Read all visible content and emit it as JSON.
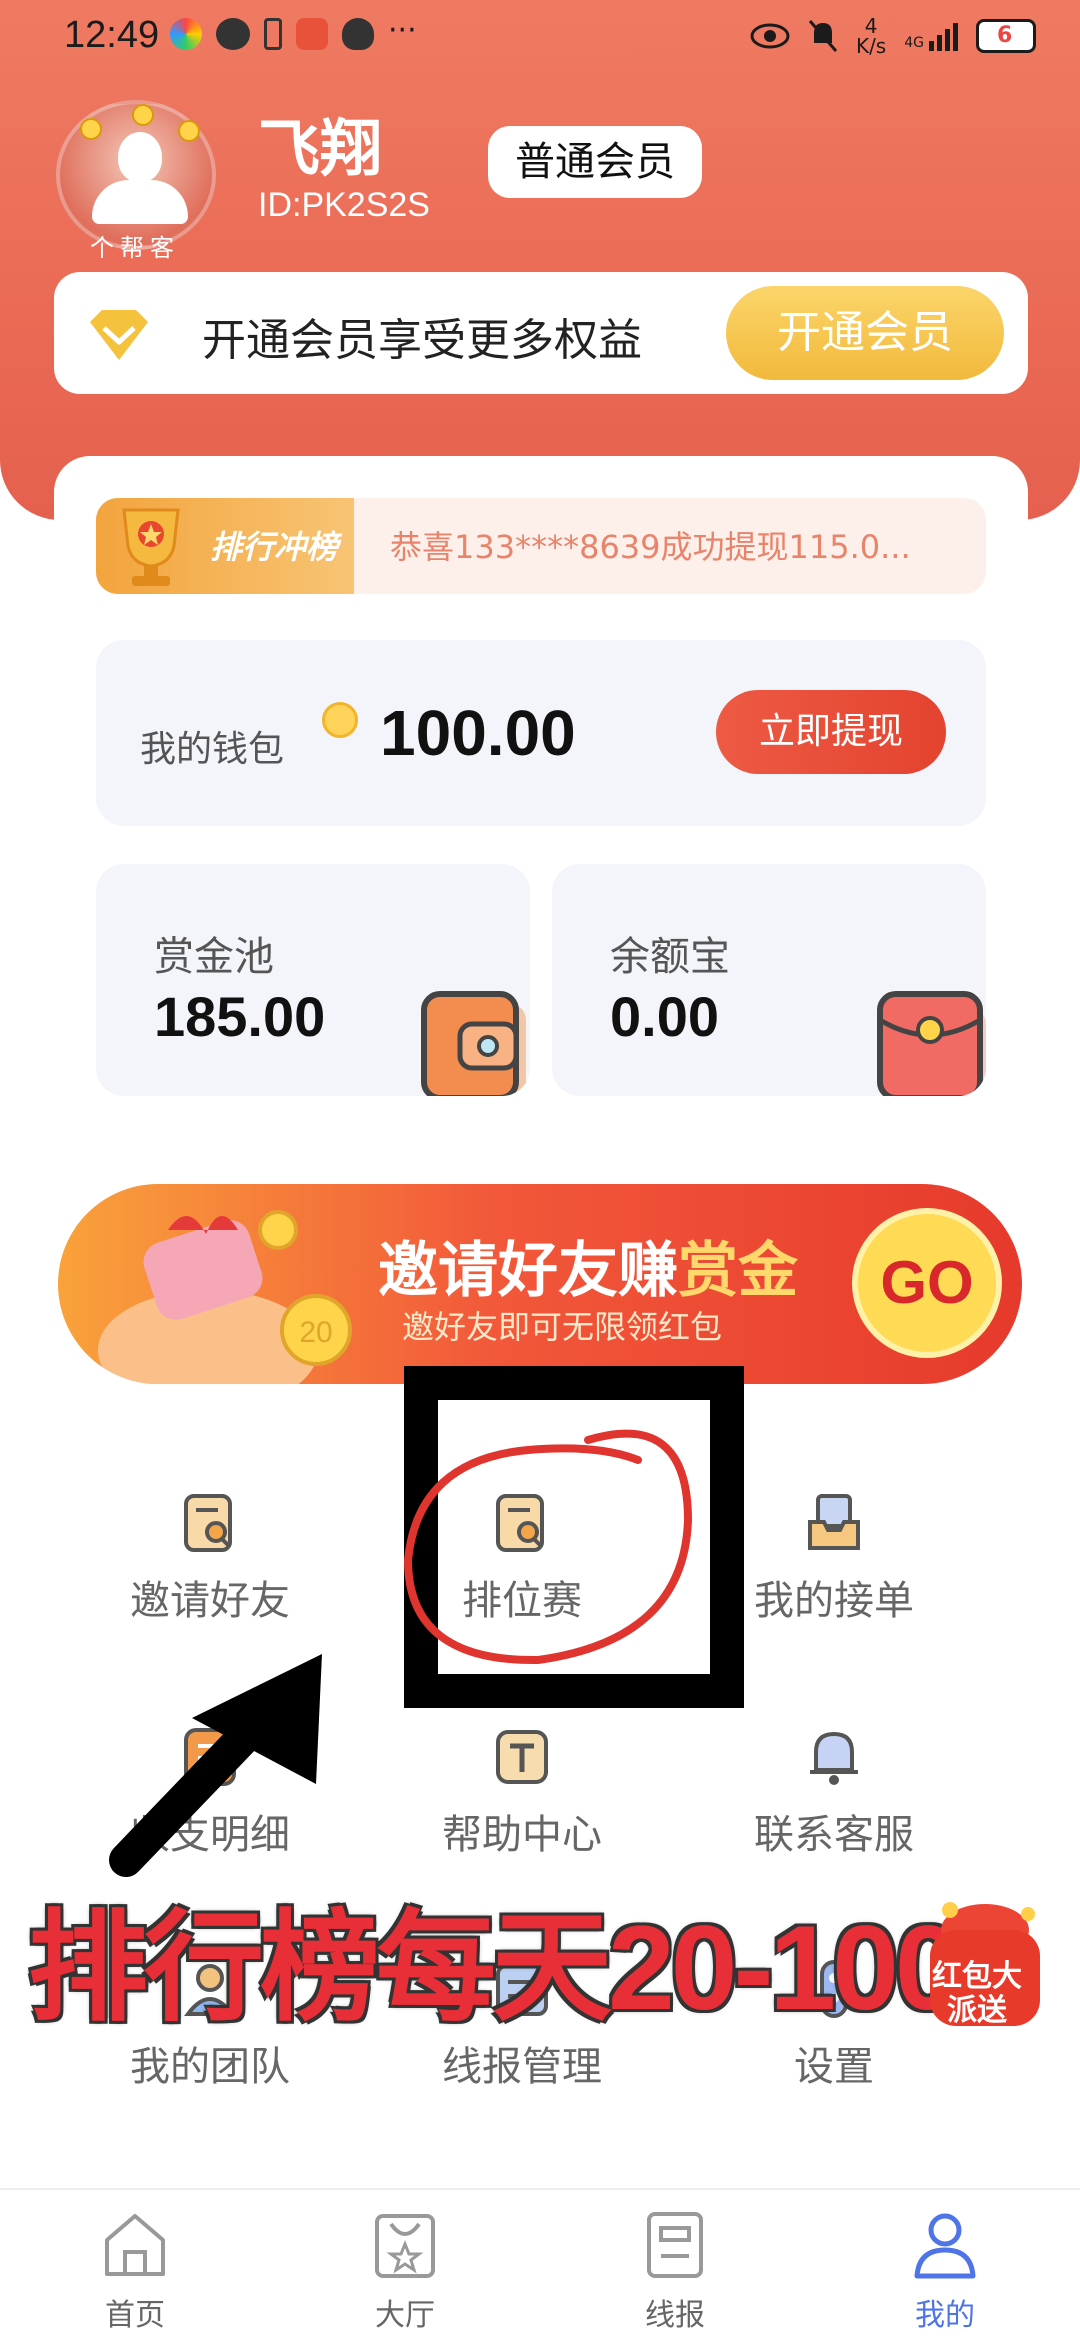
{
  "status_bar": {
    "time": "12:49",
    "net_speed_value": "4",
    "net_speed_unit": "K/s",
    "network": "4G",
    "battery": "6"
  },
  "profile": {
    "name": "飞翔",
    "id": "ID:PK2S2S",
    "member_level": "普通会员",
    "avatar_text": "个帮客"
  },
  "vip_bar": {
    "text": "开通会员享受更多权益",
    "button": "开通会员"
  },
  "rank_strip": {
    "tag": "排行冲榜",
    "news": "恭喜133****8639成功提现115.0..."
  },
  "wallet": {
    "label": "我的钱包",
    "amount": "100.00",
    "withdraw_button": "立即提现"
  },
  "bounty_pool": {
    "title": "赏金池",
    "value": "185.00"
  },
  "balance_treasure": {
    "title": "余额宝",
    "value": "0.00"
  },
  "invite_banner": {
    "title_a": "邀请好友赚",
    "title_b": "赏金",
    "subtitle": "邀好友即可无限领红包",
    "coin_label": "20",
    "go_label": "GO"
  },
  "grid": [
    {
      "label": "邀请好友",
      "icon": "document-search-icon"
    },
    {
      "label": "排位赛",
      "icon": "document-search-icon"
    },
    {
      "label": "我的接单",
      "icon": "inbox-icon"
    },
    {
      "label": "收支明细",
      "icon": "ledger-icon"
    },
    {
      "label": "帮助中心",
      "icon": "help-t-icon"
    },
    {
      "label": "联系客服",
      "icon": "bell-icon"
    },
    {
      "label": "我的团队",
      "icon": "team-icon"
    },
    {
      "label": "线报管理",
      "icon": "news-manage-icon"
    },
    {
      "label": "设置",
      "icon": "settings-icon"
    }
  ],
  "annotation": {
    "overlay_text": "排行榜每天20-100"
  },
  "redpack": {
    "text": "红包大派送"
  },
  "tabbar": [
    {
      "label": "首页",
      "icon": "home-icon",
      "active": false
    },
    {
      "label": "大厅",
      "icon": "hall-icon",
      "active": false
    },
    {
      "label": "线报",
      "icon": "news-icon",
      "active": false
    },
    {
      "label": "我的",
      "icon": "profile-icon",
      "active": true
    }
  ],
  "colors": {
    "header": "#ea6a55",
    "accent_gold": "#f2b93c",
    "active_tab": "#4e74e8",
    "annotation_red": "#e82e36"
  }
}
